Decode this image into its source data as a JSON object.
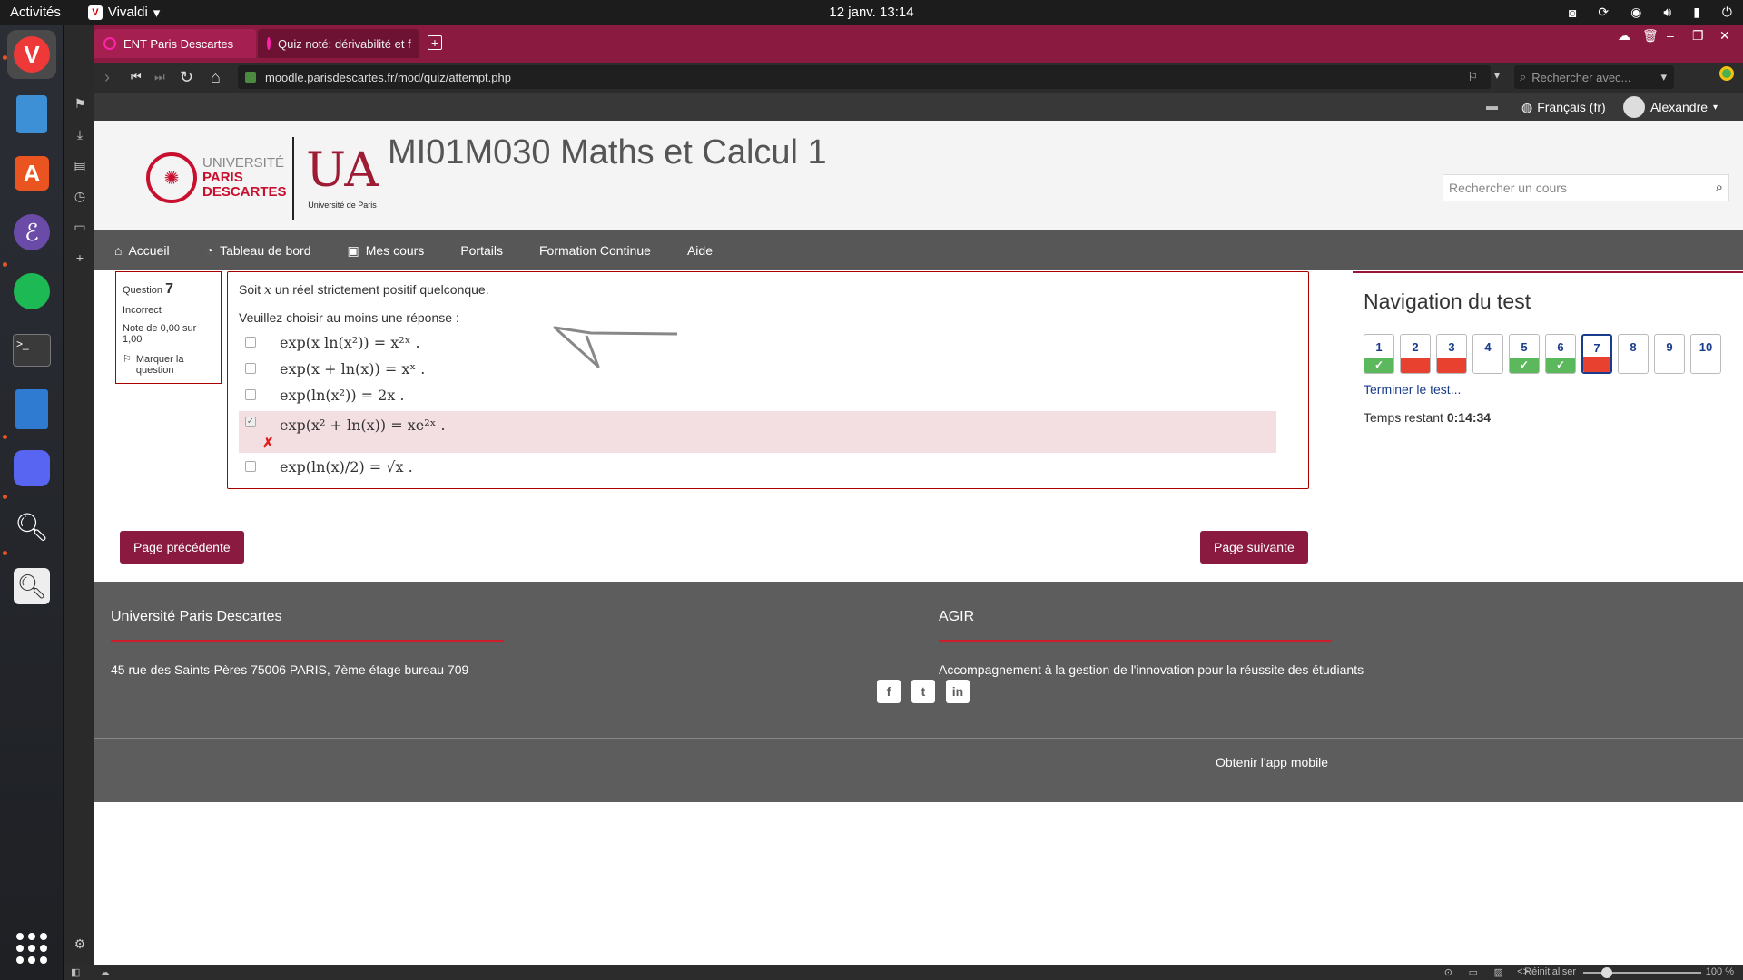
{
  "system": {
    "activities": "Activités",
    "app_name": "Vivaldi",
    "clock": "12 janv.  13:14"
  },
  "browser": {
    "tabs": [
      {
        "label": "ENT Paris Descartes"
      },
      {
        "label": "Quiz noté: dérivabilité et f"
      }
    ],
    "url": "moodle.parisdescartes.fr/mod/quiz/attempt.php",
    "search_placeholder": "Rechercher avec...",
    "status_reset": "Réinitialiser",
    "zoom": "100 %"
  },
  "moodle": {
    "userbar": {
      "language": "Français (fr)",
      "user": "Alexandre"
    },
    "logo": {
      "line1": "UNIVERSITÉ",
      "line2": "PARIS",
      "line3": "DESCARTES",
      "up_caption": "Université de Paris"
    },
    "course_title": "MI01M030 Maths et Calcul 1",
    "course_search_placeholder": "Rechercher un cours",
    "nav": [
      {
        "label": "Accueil",
        "icon": "home-icon"
      },
      {
        "label": "Tableau de bord",
        "icon": "dashboard-icon"
      },
      {
        "label": "Mes cours",
        "icon": "briefcase-icon"
      },
      {
        "label": "Portails"
      },
      {
        "label": "Formation Continue"
      },
      {
        "label": "Aide"
      }
    ]
  },
  "question": {
    "info": {
      "label": "Question",
      "number": "7",
      "state": "Incorrect",
      "grade": "Note de 0,00 sur 1,00",
      "flag": "Marquer la question"
    },
    "text_prefix": "Soit",
    "text_var": "x",
    "text_suffix": "un réel strictement positif quelconque.",
    "instruction": "Veuillez choisir au moins une réponse :",
    "answers": [
      {
        "formula": "exp(x ln(x²)) = x²ˣ .",
        "checked": false
      },
      {
        "formula": "exp(x + ln(x)) = xˣ .",
        "checked": false
      },
      {
        "formula": "exp(ln(x²)) = 2x .",
        "checked": false
      },
      {
        "formula": "exp(x² + ln(x)) = xe²ˣ .",
        "checked": true,
        "incorrect": true
      },
      {
        "formula": "exp(ln(x)/2) = √x .",
        "checked": false
      }
    ]
  },
  "quiz_nav": {
    "title": "Navigation du test",
    "questions": [
      {
        "n": "1",
        "state": "correct"
      },
      {
        "n": "2",
        "state": "incorrect"
      },
      {
        "n": "3",
        "state": "incorrect"
      },
      {
        "n": "4",
        "state": "unanswered"
      },
      {
        "n": "5",
        "state": "correct"
      },
      {
        "n": "6",
        "state": "correct"
      },
      {
        "n": "7",
        "state": "incorrect-current"
      },
      {
        "n": "8",
        "state": "unanswered"
      },
      {
        "n": "9",
        "state": "unanswered"
      },
      {
        "n": "10",
        "state": "unanswered"
      }
    ],
    "finish": "Terminer le test...",
    "time_label": "Temps restant",
    "time_value": "0:14:34"
  },
  "buttons": {
    "prev": "Page précédente",
    "next": "Page suivante"
  },
  "footer": {
    "left_title": "Université Paris Descartes",
    "left_text": "45 rue des Saints-Pères  75006 PARIS, 7ème étage bureau 709",
    "right_title": "AGIR",
    "right_text": "Accompagnement à la gestion de l'innovation pour la réussite des étudiants",
    "mobile": "Obtenir l'app mobile"
  },
  "colors": {
    "brand": "#8b1a41",
    "correct": "#5cb85c",
    "incorrect": "#e8412f"
  }
}
